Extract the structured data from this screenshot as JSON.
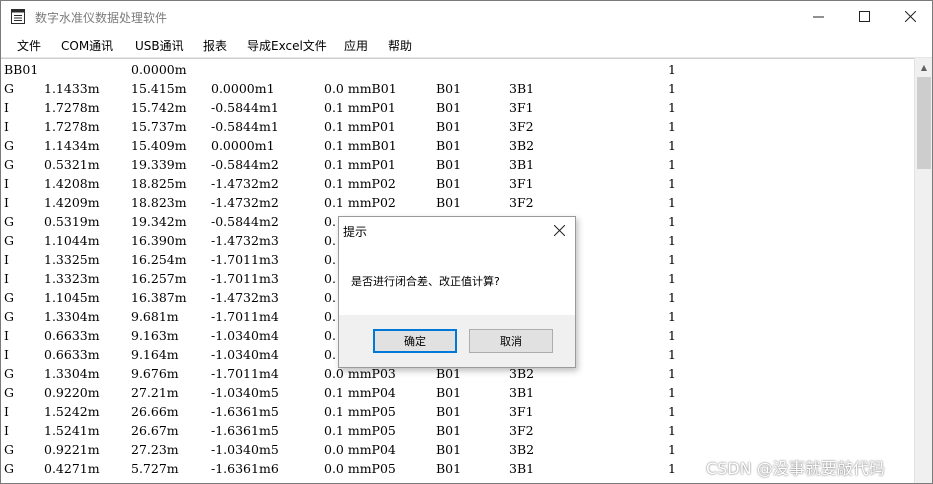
{
  "window": {
    "title": "数字水准仪数据处理软件",
    "icon": "notepad-icon",
    "controls": [
      "minimize-icon",
      "maximize-icon",
      "close-icon"
    ]
  },
  "menu": [
    "文件",
    "COM通讯",
    "USB通讯",
    "报表",
    "导成Excel文件",
    "应用",
    "帮助"
  ],
  "editor": {
    "lines": [
      [
        "BB01",
        "",
        "0.0000m",
        "",
        "",
        "",
        "",
        "1"
      ],
      [
        "G",
        "1.1433m",
        "15.415m",
        "0.0000m1",
        "0.0 mmB01",
        "B01",
        "3B1",
        "1"
      ],
      [
        "I",
        "1.7278m",
        "15.742m",
        "-0.5844m1",
        "0.1 mmP01",
        "B01",
        "3F1",
        "1"
      ],
      [
        "I",
        "1.7278m",
        "15.737m",
        "-0.5844m1",
        "0.1 mmP01",
        "B01",
        "3F2",
        "1"
      ],
      [
        "G",
        "1.1434m",
        "15.409m",
        "0.0000m1",
        "0.1 mmB01",
        "B01",
        "3B2",
        "1"
      ],
      [
        "G",
        "0.5321m",
        "19.339m",
        "-0.5844m2",
        "0.1 mmP01",
        "B01",
        "3B1",
        "1"
      ],
      [
        "I",
        "1.4208m",
        "18.825m",
        "-1.4732m2",
        "0.1 mmP02",
        "B01",
        "3F1",
        "1"
      ],
      [
        "I",
        "1.4209m",
        "18.823m",
        "-1.4732m2",
        "0.1 mmP02",
        "B01",
        "3F2",
        "1"
      ],
      [
        "G",
        "0.5319m",
        "19.342m",
        "-0.5844m2",
        "0.",
        "",
        "",
        "1"
      ],
      [
        "G",
        "1.1044m",
        "16.390m",
        "-1.4732m3",
        "0.",
        "",
        "",
        "1"
      ],
      [
        "I",
        "1.3325m",
        "16.254m",
        "-1.7011m3",
        "0.",
        "",
        "",
        "1"
      ],
      [
        "I",
        "1.3323m",
        "16.257m",
        "-1.7011m3",
        "0.",
        "",
        "",
        "1"
      ],
      [
        "G",
        "1.1045m",
        "16.387m",
        "-1.4732m3",
        "0.",
        "",
        "",
        "1"
      ],
      [
        "G",
        "1.3304m",
        "9.681m",
        "-1.7011m4",
        "0.",
        "",
        "",
        "1"
      ],
      [
        "I",
        "0.6633m",
        "9.163m",
        "-1.0340m4",
        "0.",
        "",
        "",
        "1"
      ],
      [
        "I",
        "0.6633m",
        "9.164m",
        "-1.0340m4",
        "0.",
        "",
        "",
        "1"
      ],
      [
        "G",
        "1.3304m",
        "9.676m",
        "-1.7011m4",
        "0.0 mmP03",
        "B01",
        "3B2",
        "1"
      ],
      [
        "G",
        "0.9220m",
        "27.21m",
        "-1.0340m5",
        "0.1 mmP04",
        "B01",
        "3B1",
        "1"
      ],
      [
        "I",
        "1.5242m",
        "26.66m",
        "-1.6361m5",
        "0.1 mmP05",
        "B01",
        "3F1",
        "1"
      ],
      [
        "I",
        "1.5241m",
        "26.67m",
        "-1.6361m5",
        "0.1 mmP05",
        "B01",
        "3F2",
        "1"
      ],
      [
        "G",
        "0.9221m",
        "27.23m",
        "-1.0340m5",
        "0.0 mmP04",
        "B01",
        "3B2",
        "1"
      ],
      [
        "G",
        "0.4271m",
        "5.727m",
        "-1.6361m6",
        "0.0 mmP05",
        "B01",
        "3B1",
        "1"
      ]
    ]
  },
  "dialog": {
    "title": "提示",
    "message": "是否进行闭合差、改正值计算?",
    "ok_label": "确定",
    "cancel_label": "取消"
  },
  "watermark": "CSDN @没事就要敲代码"
}
